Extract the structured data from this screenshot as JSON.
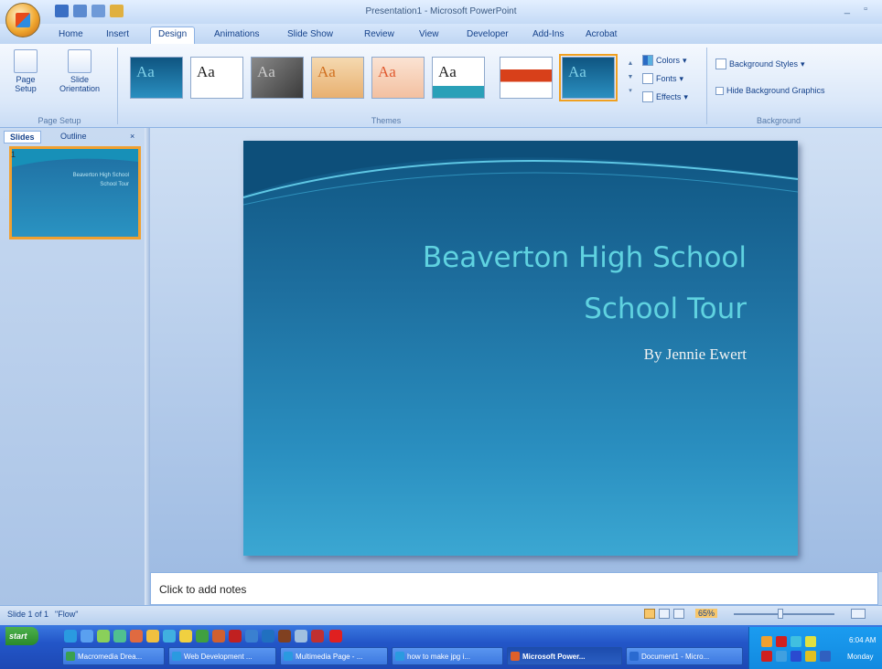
{
  "window": {
    "title": "Presentation1 - Microsoft PowerPoint"
  },
  "tabs": [
    "Home",
    "Insert",
    "Design",
    "Animations",
    "Slide Show",
    "Review",
    "View",
    "Developer",
    "Add-Ins",
    "Acrobat"
  ],
  "active_tab": "Design",
  "ribbon": {
    "page_setup": {
      "page_setup_label": "Page Setup",
      "slide_orientation_label": "Slide Orientation",
      "group_label": "Page Setup"
    },
    "themes": {
      "group_label": "Themes",
      "sample_text": "Aa"
    },
    "theme_options": {
      "colors": "Colors",
      "fonts": "Fonts",
      "effects": "Effects"
    },
    "background": {
      "styles": "Background Styles",
      "hide_graphics": "Hide Background Graphics",
      "group_label": "Background"
    }
  },
  "pane": {
    "tab_slides": "Slides",
    "tab_outline": "Outline",
    "close": "×",
    "thumb_number": "1",
    "thumb_title1": "Beaverton High School",
    "thumb_title2": "School Tour"
  },
  "slide": {
    "title_line1": "Beaverton High School",
    "title_line2": "School Tour",
    "subtitle": "By  Jennie Ewert"
  },
  "notes": {
    "placeholder": "Click to add notes"
  },
  "status": {
    "slide_count": "Slide 1 of 1",
    "theme": "\"Flow\"",
    "zoom": "65%"
  },
  "taskbar": {
    "start": "start",
    "tasks": [
      "Macromedia Drea...",
      "Web Development ...",
      "Multimedia Page - ...",
      "how to make jpg i...",
      "Microsoft Power...",
      "Document1 - Micro..."
    ],
    "active_index": 4,
    "clock": "6:04 AM",
    "day": "Monday"
  },
  "colors": {
    "accent": "#f0a030",
    "slide_title": "#5fd2e0",
    "taskbar": "#2356c8"
  }
}
